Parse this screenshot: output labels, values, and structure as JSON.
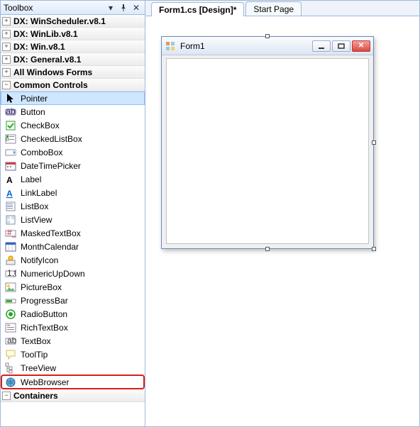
{
  "toolbox": {
    "title": "Toolbox",
    "groups": [
      {
        "label": "DX: WinScheduler.v8.1",
        "expanded": false
      },
      {
        "label": "DX: WinLib.v8.1",
        "expanded": false
      },
      {
        "label": "DX: Win.v8.1",
        "expanded": false
      },
      {
        "label": "DX: General.v8.1",
        "expanded": false
      },
      {
        "label": "All Windows Forms",
        "expanded": false
      }
    ],
    "common_controls_label": "Common Controls",
    "items": [
      {
        "label": "Pointer",
        "icon": "pointer",
        "selected": true
      },
      {
        "label": "Button",
        "icon": "button"
      },
      {
        "label": "CheckBox",
        "icon": "checkbox"
      },
      {
        "label": "CheckedListBox",
        "icon": "checkedlist"
      },
      {
        "label": "ComboBox",
        "icon": "combo"
      },
      {
        "label": "DateTimePicker",
        "icon": "datetime"
      },
      {
        "label": "Label",
        "icon": "label"
      },
      {
        "label": "LinkLabel",
        "icon": "link"
      },
      {
        "label": "ListBox",
        "icon": "listbox"
      },
      {
        "label": "ListView",
        "icon": "listview"
      },
      {
        "label": "MaskedTextBox",
        "icon": "masked"
      },
      {
        "label": "MonthCalendar",
        "icon": "calendar"
      },
      {
        "label": "NotifyIcon",
        "icon": "notify"
      },
      {
        "label": "NumericUpDown",
        "icon": "numeric"
      },
      {
        "label": "PictureBox",
        "icon": "picture"
      },
      {
        "label": "ProgressBar",
        "icon": "progress"
      },
      {
        "label": "RadioButton",
        "icon": "radio"
      },
      {
        "label": "RichTextBox",
        "icon": "richtext"
      },
      {
        "label": "TextBox",
        "icon": "textbox"
      },
      {
        "label": "ToolTip",
        "icon": "tooltip"
      },
      {
        "label": "TreeView",
        "icon": "tree"
      },
      {
        "label": "WebBrowser",
        "icon": "webbrowser",
        "highlight": true
      }
    ],
    "containers_label": "Containers"
  },
  "tabs": [
    {
      "label": "Form1.cs [Design]*",
      "active": true
    },
    {
      "label": "Start Page",
      "active": false
    }
  ],
  "form": {
    "title": "Form1"
  }
}
